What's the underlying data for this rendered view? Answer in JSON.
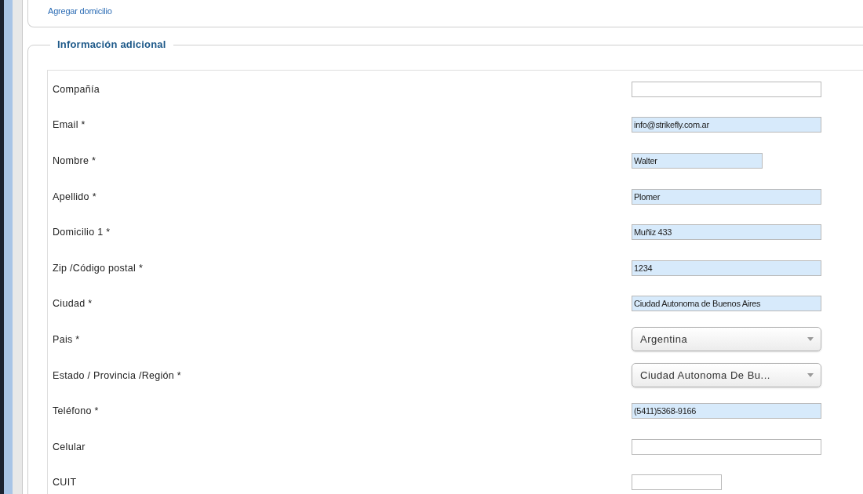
{
  "top_panel": {
    "link": "Agregar domicilio"
  },
  "section": {
    "legend": "Información adicional",
    "fields": [
      {
        "label": "Compañía",
        "kind": "text",
        "highlighted": false
      },
      {
        "label": "Email *",
        "kind": "text",
        "value": "info@strikefly.com.ar",
        "highlighted": true
      },
      {
        "label": "Nombre *",
        "kind": "text",
        "value": "Walter",
        "highlighted": true
      },
      {
        "label": "Apellido *",
        "kind": "text",
        "value": "Plomer",
        "highlighted": true
      },
      {
        "label": "Domicilio 1 *",
        "kind": "text",
        "value": "Muñiz 433",
        "highlighted": true
      },
      {
        "label": "Zip /Código postal *",
        "kind": "text",
        "value": "1234",
        "highlighted": true
      },
      {
        "label": "Ciudad *",
        "kind": "text",
        "value": "Ciudad Autonoma de Buenos Aires",
        "highlighted": true
      },
      {
        "label": "Pais *",
        "kind": "select",
        "value": "Argentina",
        "highlighted": false
      },
      {
        "label": "Estado / Provincia /Región *",
        "kind": "select",
        "value": "Ciudad Autonoma De Bu...",
        "highlighted": false
      },
      {
        "label": "Teléfono *",
        "kind": "text",
        "value": "(5411)5368-9166",
        "highlighted": true
      },
      {
        "label": "Celular",
        "kind": "text",
        "highlighted": false
      },
      {
        "label": "CUIT",
        "kind": "text",
        "highlighted": false
      }
    ]
  }
}
